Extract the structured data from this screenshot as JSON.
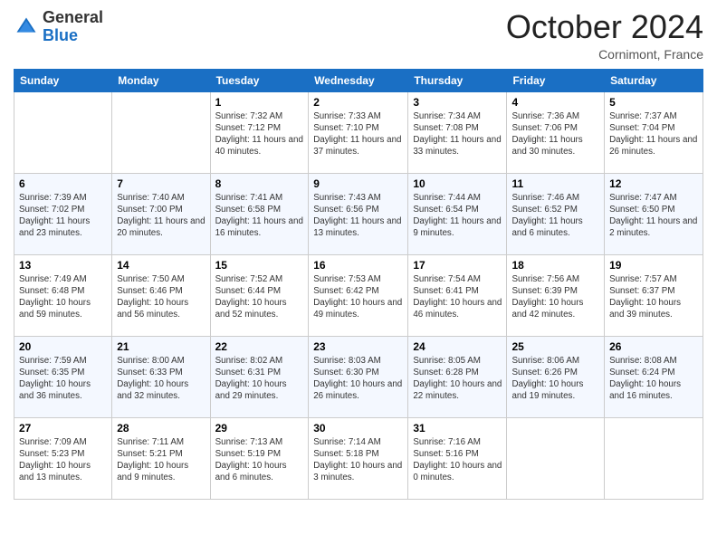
{
  "logo": {
    "general": "General",
    "blue": "Blue"
  },
  "header": {
    "month": "October 2024",
    "location": "Cornimont, France"
  },
  "days_of_week": [
    "Sunday",
    "Monday",
    "Tuesday",
    "Wednesday",
    "Thursday",
    "Friday",
    "Saturday"
  ],
  "weeks": [
    [
      {
        "day": "",
        "sunrise": "",
        "sunset": "",
        "daylight": ""
      },
      {
        "day": "",
        "sunrise": "",
        "sunset": "",
        "daylight": ""
      },
      {
        "day": "1",
        "sunrise": "Sunrise: 7:32 AM",
        "sunset": "Sunset: 7:12 PM",
        "daylight": "Daylight: 11 hours and 40 minutes."
      },
      {
        "day": "2",
        "sunrise": "Sunrise: 7:33 AM",
        "sunset": "Sunset: 7:10 PM",
        "daylight": "Daylight: 11 hours and 37 minutes."
      },
      {
        "day": "3",
        "sunrise": "Sunrise: 7:34 AM",
        "sunset": "Sunset: 7:08 PM",
        "daylight": "Daylight: 11 hours and 33 minutes."
      },
      {
        "day": "4",
        "sunrise": "Sunrise: 7:36 AM",
        "sunset": "Sunset: 7:06 PM",
        "daylight": "Daylight: 11 hours and 30 minutes."
      },
      {
        "day": "5",
        "sunrise": "Sunrise: 7:37 AM",
        "sunset": "Sunset: 7:04 PM",
        "daylight": "Daylight: 11 hours and 26 minutes."
      }
    ],
    [
      {
        "day": "6",
        "sunrise": "Sunrise: 7:39 AM",
        "sunset": "Sunset: 7:02 PM",
        "daylight": "Daylight: 11 hours and 23 minutes."
      },
      {
        "day": "7",
        "sunrise": "Sunrise: 7:40 AM",
        "sunset": "Sunset: 7:00 PM",
        "daylight": "Daylight: 11 hours and 20 minutes."
      },
      {
        "day": "8",
        "sunrise": "Sunrise: 7:41 AM",
        "sunset": "Sunset: 6:58 PM",
        "daylight": "Daylight: 11 hours and 16 minutes."
      },
      {
        "day": "9",
        "sunrise": "Sunrise: 7:43 AM",
        "sunset": "Sunset: 6:56 PM",
        "daylight": "Daylight: 11 hours and 13 minutes."
      },
      {
        "day": "10",
        "sunrise": "Sunrise: 7:44 AM",
        "sunset": "Sunset: 6:54 PM",
        "daylight": "Daylight: 11 hours and 9 minutes."
      },
      {
        "day": "11",
        "sunrise": "Sunrise: 7:46 AM",
        "sunset": "Sunset: 6:52 PM",
        "daylight": "Daylight: 11 hours and 6 minutes."
      },
      {
        "day": "12",
        "sunrise": "Sunrise: 7:47 AM",
        "sunset": "Sunset: 6:50 PM",
        "daylight": "Daylight: 11 hours and 2 minutes."
      }
    ],
    [
      {
        "day": "13",
        "sunrise": "Sunrise: 7:49 AM",
        "sunset": "Sunset: 6:48 PM",
        "daylight": "Daylight: 10 hours and 59 minutes."
      },
      {
        "day": "14",
        "sunrise": "Sunrise: 7:50 AM",
        "sunset": "Sunset: 6:46 PM",
        "daylight": "Daylight: 10 hours and 56 minutes."
      },
      {
        "day": "15",
        "sunrise": "Sunrise: 7:52 AM",
        "sunset": "Sunset: 6:44 PM",
        "daylight": "Daylight: 10 hours and 52 minutes."
      },
      {
        "day": "16",
        "sunrise": "Sunrise: 7:53 AM",
        "sunset": "Sunset: 6:42 PM",
        "daylight": "Daylight: 10 hours and 49 minutes."
      },
      {
        "day": "17",
        "sunrise": "Sunrise: 7:54 AM",
        "sunset": "Sunset: 6:41 PM",
        "daylight": "Daylight: 10 hours and 46 minutes."
      },
      {
        "day": "18",
        "sunrise": "Sunrise: 7:56 AM",
        "sunset": "Sunset: 6:39 PM",
        "daylight": "Daylight: 10 hours and 42 minutes."
      },
      {
        "day": "19",
        "sunrise": "Sunrise: 7:57 AM",
        "sunset": "Sunset: 6:37 PM",
        "daylight": "Daylight: 10 hours and 39 minutes."
      }
    ],
    [
      {
        "day": "20",
        "sunrise": "Sunrise: 7:59 AM",
        "sunset": "Sunset: 6:35 PM",
        "daylight": "Daylight: 10 hours and 36 minutes."
      },
      {
        "day": "21",
        "sunrise": "Sunrise: 8:00 AM",
        "sunset": "Sunset: 6:33 PM",
        "daylight": "Daylight: 10 hours and 32 minutes."
      },
      {
        "day": "22",
        "sunrise": "Sunrise: 8:02 AM",
        "sunset": "Sunset: 6:31 PM",
        "daylight": "Daylight: 10 hours and 29 minutes."
      },
      {
        "day": "23",
        "sunrise": "Sunrise: 8:03 AM",
        "sunset": "Sunset: 6:30 PM",
        "daylight": "Daylight: 10 hours and 26 minutes."
      },
      {
        "day": "24",
        "sunrise": "Sunrise: 8:05 AM",
        "sunset": "Sunset: 6:28 PM",
        "daylight": "Daylight: 10 hours and 22 minutes."
      },
      {
        "day": "25",
        "sunrise": "Sunrise: 8:06 AM",
        "sunset": "Sunset: 6:26 PM",
        "daylight": "Daylight: 10 hours and 19 minutes."
      },
      {
        "day": "26",
        "sunrise": "Sunrise: 8:08 AM",
        "sunset": "Sunset: 6:24 PM",
        "daylight": "Daylight: 10 hours and 16 minutes."
      }
    ],
    [
      {
        "day": "27",
        "sunrise": "Sunrise: 7:09 AM",
        "sunset": "Sunset: 5:23 PM",
        "daylight": "Daylight: 10 hours and 13 minutes."
      },
      {
        "day": "28",
        "sunrise": "Sunrise: 7:11 AM",
        "sunset": "Sunset: 5:21 PM",
        "daylight": "Daylight: 10 hours and 9 minutes."
      },
      {
        "day": "29",
        "sunrise": "Sunrise: 7:13 AM",
        "sunset": "Sunset: 5:19 PM",
        "daylight": "Daylight: 10 hours and 6 minutes."
      },
      {
        "day": "30",
        "sunrise": "Sunrise: 7:14 AM",
        "sunset": "Sunset: 5:18 PM",
        "daylight": "Daylight: 10 hours and 3 minutes."
      },
      {
        "day": "31",
        "sunrise": "Sunrise: 7:16 AM",
        "sunset": "Sunset: 5:16 PM",
        "daylight": "Daylight: 10 hours and 0 minutes."
      },
      {
        "day": "",
        "sunrise": "",
        "sunset": "",
        "daylight": ""
      },
      {
        "day": "",
        "sunrise": "",
        "sunset": "",
        "daylight": ""
      }
    ]
  ]
}
